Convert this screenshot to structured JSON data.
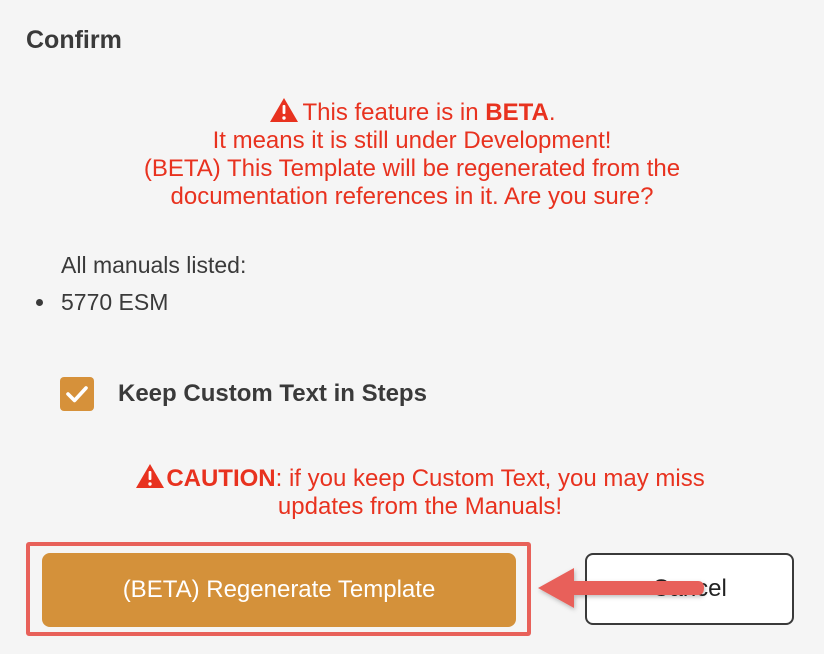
{
  "dialog": {
    "title": "Confirm"
  },
  "beta_notice": {
    "line1_prefix": "This feature is in ",
    "line1_bold": "BETA",
    "line1_suffix": ".",
    "line2": "It means it is still under Development!",
    "line3": "(BETA) This Template will be regenerated from the",
    "line4": "documentation references in it. Are you sure?",
    "icon": "warning-triangle-icon",
    "color": "#e8321f"
  },
  "manuals": {
    "label": "All manuals listed:",
    "items": [
      "5770 ESM"
    ]
  },
  "keep_custom_text": {
    "label": "Keep Custom Text in Steps",
    "checked": true,
    "color": "#d6913a"
  },
  "caution": {
    "bold": "CAUTION",
    "line1_suffix": ": if you keep Custom Text, you may miss",
    "line2": "updates from the Manuals!",
    "icon": "warning-triangle-icon"
  },
  "buttons": {
    "regenerate_label": "(BETA) Regenerate Template",
    "regenerate_color": "#d4913a",
    "cancel_label": "Cancel"
  },
  "annotation": {
    "highlight_color": "#e8615a",
    "arrow_icon": "arrow-left-icon"
  }
}
